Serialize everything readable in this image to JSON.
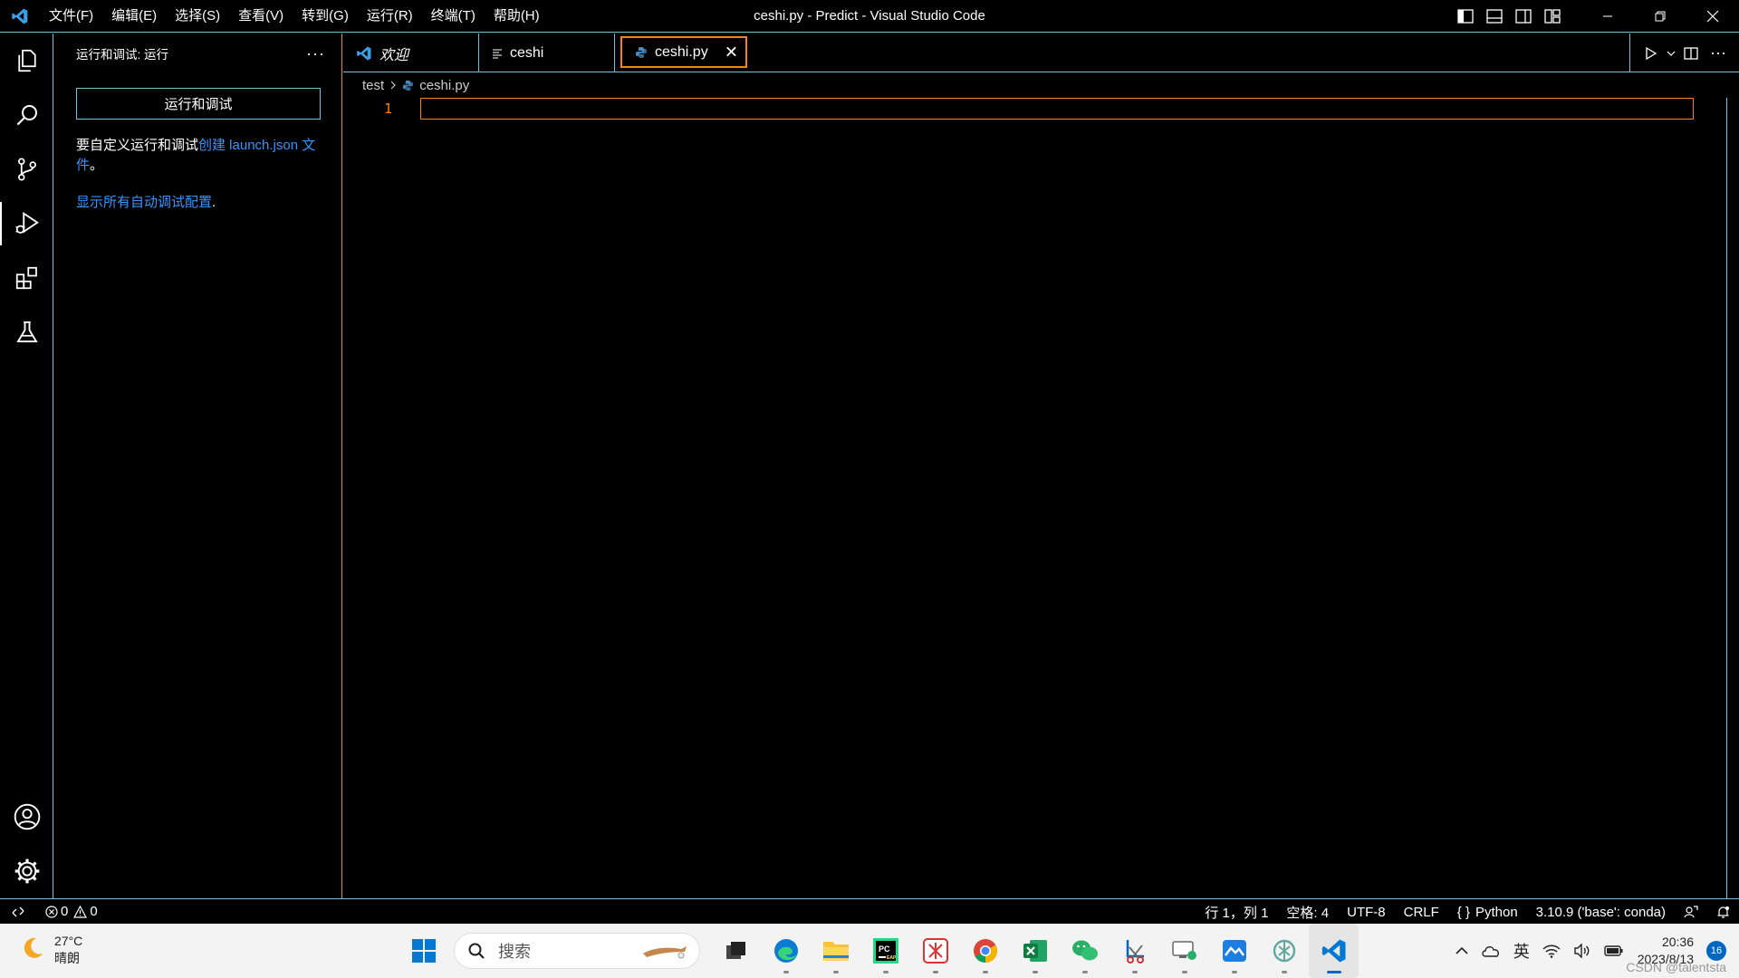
{
  "titlebar": {
    "menus": [
      "文件(F)",
      "编辑(E)",
      "选择(S)",
      "查看(V)",
      "转到(G)",
      "运行(R)",
      "终端(T)",
      "帮助(H)"
    ],
    "title": "ceshi.py - Predict - Visual Studio Code"
  },
  "sidebar": {
    "header": "运行和调试: 运行",
    "run_button": "运行和调试",
    "text_prefix": "要自定义运行和调试",
    "text_link": "创建 launch.json 文件",
    "text_suffix": "。",
    "show_all_link": "显示所有自动调试配置",
    "show_all_suffix": "."
  },
  "tabs": [
    {
      "label": "欢迎",
      "icon": "vscode-icon"
    },
    {
      "label": "ceshi",
      "icon": "text-file-icon"
    },
    {
      "label": "ceshi.py",
      "icon": "python-icon",
      "active": true
    }
  ],
  "breadcrumb": {
    "folder": "test",
    "file": "ceshi.py"
  },
  "editor": {
    "line_number": "1"
  },
  "statusbar": {
    "errors": "0",
    "warnings": "0",
    "cursor": "行 1，列 1",
    "spaces": "空格: 4",
    "encoding": "UTF-8",
    "eol": "CRLF",
    "language": "Python",
    "interpreter": "3.10.9 ('base': conda)"
  },
  "taskbar": {
    "temperature": "27°C",
    "weather": "晴朗",
    "search_placeholder": "搜索",
    "ime": "英",
    "time": "20:36",
    "date": "2023/8/13",
    "notifications": "16"
  },
  "watermark": "CSDN @talentsta",
  "colors": {
    "contrast_border": "#6fc3df",
    "active_border": "#f38518",
    "link": "#3794ff"
  }
}
